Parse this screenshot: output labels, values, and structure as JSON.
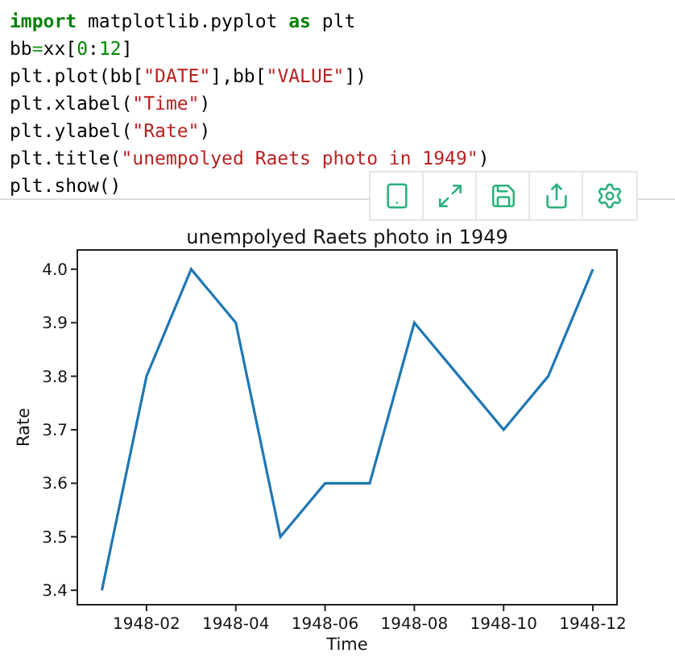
{
  "code_cell": {
    "lines": [
      {
        "tokens": [
          {
            "kind": "keyword",
            "text": "import"
          },
          {
            "kind": "plain",
            "text": " matplotlib.pyplot "
          },
          {
            "kind": "keyword",
            "text": "as"
          },
          {
            "kind": "plain",
            "text": " plt"
          }
        ]
      },
      {
        "tokens": [
          {
            "kind": "plain",
            "text": "bb"
          },
          {
            "kind": "operator",
            "text": "="
          },
          {
            "kind": "plain",
            "text": "xx["
          },
          {
            "kind": "number",
            "text": "0"
          },
          {
            "kind": "plain",
            "text": ":"
          },
          {
            "kind": "number",
            "text": "12"
          },
          {
            "kind": "plain",
            "text": "]"
          }
        ]
      },
      {
        "tokens": [
          {
            "kind": "plain",
            "text": "plt.plot(bb["
          },
          {
            "kind": "string",
            "text": "\"DATE\""
          },
          {
            "kind": "plain",
            "text": "],bb["
          },
          {
            "kind": "string",
            "text": "\"VALUE\""
          },
          {
            "kind": "plain",
            "text": "])"
          }
        ]
      },
      {
        "tokens": [
          {
            "kind": "plain",
            "text": "plt.xlabel("
          },
          {
            "kind": "string",
            "text": "\"Time\""
          },
          {
            "kind": "plain",
            "text": ")"
          }
        ]
      },
      {
        "tokens": [
          {
            "kind": "plain",
            "text": "plt.ylabel("
          },
          {
            "kind": "string",
            "text": "\"Rate\""
          },
          {
            "kind": "plain",
            "text": ")"
          }
        ]
      },
      {
        "tokens": [
          {
            "kind": "plain",
            "text": "plt.title("
          },
          {
            "kind": "string",
            "text": "\"unempolyed Raets photo in 1949\""
          },
          {
            "kind": "plain",
            "text": ")"
          }
        ]
      },
      {
        "tokens": [
          {
            "kind": "plain",
            "text": "plt.show()"
          }
        ]
      }
    ]
  },
  "output": {
    "chart_data": {
      "type": "line",
      "title": "unempolyed Raets photo in 1949",
      "xlabel": "Time",
      "ylabel": "Rate",
      "categories": [
        null,
        "1948-02",
        null,
        "1948-04",
        null,
        "1948-06",
        null,
        "1948-08",
        null,
        "1948-10",
        null,
        "1948-12"
      ],
      "series": [
        {
          "color": "#1f77b4",
          "values": [
            3.4,
            3.8,
            4.0,
            3.9,
            3.5,
            3.6,
            3.6,
            3.9,
            3.8,
            3.7,
            3.8,
            4.0
          ]
        }
      ],
      "ylim": [
        3.373,
        4.036
      ],
      "yticks": [
        {
          "value": 3.4,
          "label": "3.4"
        },
        {
          "value": 3.5,
          "label": "3.5"
        },
        {
          "value": 3.6,
          "label": "3.6"
        },
        {
          "value": 3.7,
          "label": "3.7"
        },
        {
          "value": 3.8,
          "label": "3.8"
        },
        {
          "value": 3.9,
          "label": "3.9"
        },
        {
          "value": 4.0,
          "label": "4.0"
        }
      ]
    }
  }
}
